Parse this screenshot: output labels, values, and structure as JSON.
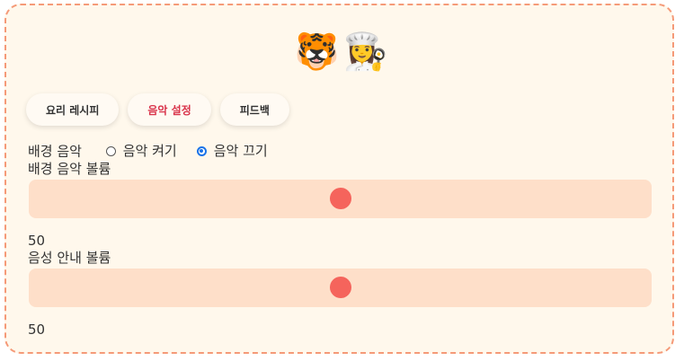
{
  "header": {
    "mascots": [
      {
        "icon": "tiger-cat-face-icon",
        "glyph": "🐯"
      },
      {
        "icon": "chef-icon",
        "glyph": "👩‍🍳"
      }
    ]
  },
  "tabs": [
    {
      "label": "요리 레시피",
      "active": false
    },
    {
      "label": "음악 설정",
      "active": true
    },
    {
      "label": "피드백",
      "active": false
    }
  ],
  "bgm": {
    "label": "배경 음악",
    "options": [
      {
        "label": "음악 켜기",
        "checked": false
      },
      {
        "label": "음악 끄기",
        "checked": true
      }
    ]
  },
  "bgm_volume": {
    "label": "배경 음악 볼륨",
    "value": "50",
    "max": 100
  },
  "voice_volume": {
    "label": "음성 안내 볼륨",
    "value": "50",
    "max": 100
  },
  "colors": {
    "accent": "#f5645c",
    "track": "#fedfc9",
    "active_tab": "#d9334a",
    "border": "#f59a78"
  }
}
